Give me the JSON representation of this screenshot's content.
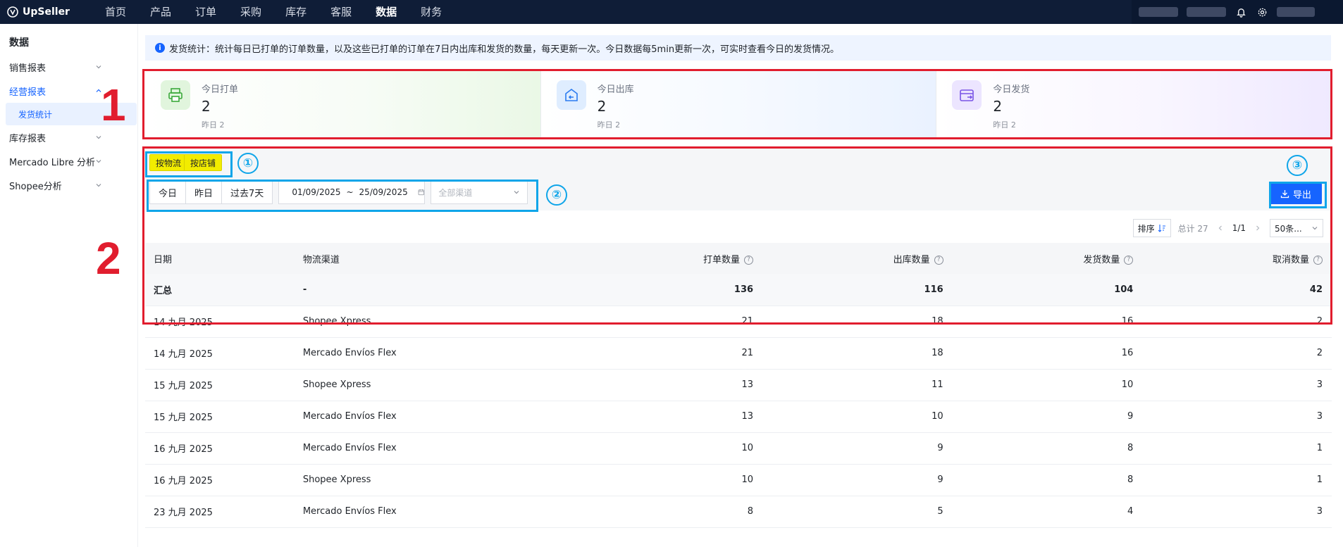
{
  "app": {
    "logo_text": "UpSeller"
  },
  "nav": {
    "items": [
      "首页",
      "产品",
      "订单",
      "采购",
      "库存",
      "客服",
      "数据",
      "财务"
    ],
    "active_index": 6
  },
  "sidebar": {
    "title": "数据",
    "items": [
      {
        "label": "销售报表",
        "open": false
      },
      {
        "label": "经营报表",
        "open": true
      },
      {
        "label": "库存报表",
        "open": false
      },
      {
        "label": "Mercado Libre 分析",
        "open": false
      },
      {
        "label": "Shopee分析",
        "open": false
      }
    ],
    "sub_item": "发货统计"
  },
  "notice": {
    "text": "发货统计：统计每日已打单的订单数量，以及这些已打单的订单在7日内出库和发货的数量，每天更新一次。今日数据每5min更新一次，可实时查看今日的发货情况。"
  },
  "stats": [
    {
      "label": "今日打单",
      "value": "2",
      "sub": "昨日 2",
      "icon": "printer-icon"
    },
    {
      "label": "今日出库",
      "value": "2",
      "sub": "昨日 2",
      "icon": "outbound-icon"
    },
    {
      "label": "今日发货",
      "value": "2",
      "sub": "昨日 2",
      "icon": "shipping-icon"
    }
  ],
  "toggles": {
    "by_logistics": "按物流",
    "by_store": "按店铺"
  },
  "filters": {
    "quick": [
      "今日",
      "昨日",
      "过去7天"
    ],
    "date_start": "01/09/2025",
    "date_sep": "~",
    "date_end": "25/09/2025",
    "channel_placeholder": "全部渠道"
  },
  "export_label": "导出",
  "annotations": {
    "num1": "1",
    "num2": "2",
    "circle1": "①",
    "circle2": "②",
    "circle3": "③"
  },
  "pager": {
    "sort_label": "排序",
    "total": "总计 27",
    "page": "1/1",
    "size": "50条..."
  },
  "table": {
    "headers": [
      "日期",
      "物流渠道",
      "打单数量",
      "出库数量",
      "发货数量",
      "取消数量"
    ],
    "total": {
      "label": "汇总",
      "channel": "-",
      "printed": "136",
      "outbound": "116",
      "shipped": "104",
      "cancelled": "42"
    },
    "rows": [
      {
        "date": "14 九月 2025",
        "channel": "Shopee Xpress",
        "printed": "21",
        "outbound": "18",
        "shipped": "16",
        "cancelled": "2"
      },
      {
        "date": "14 九月 2025",
        "channel": "Mercado Envíos Flex",
        "printed": "21",
        "outbound": "18",
        "shipped": "16",
        "cancelled": "2"
      },
      {
        "date": "15 九月 2025",
        "channel": "Shopee Xpress",
        "printed": "13",
        "outbound": "11",
        "shipped": "10",
        "cancelled": "3"
      },
      {
        "date": "15 九月 2025",
        "channel": "Mercado Envíos Flex",
        "printed": "13",
        "outbound": "10",
        "shipped": "9",
        "cancelled": "3"
      },
      {
        "date": "16 九月 2025",
        "channel": "Mercado Envíos Flex",
        "printed": "10",
        "outbound": "9",
        "shipped": "8",
        "cancelled": "1"
      },
      {
        "date": "16 九月 2025",
        "channel": "Shopee Xpress",
        "printed": "10",
        "outbound": "9",
        "shipped": "8",
        "cancelled": "1"
      },
      {
        "date": "23 九月 2025",
        "channel": "Mercado Envíos Flex",
        "printed": "8",
        "outbound": "5",
        "shipped": "4",
        "cancelled": "3"
      }
    ]
  },
  "colors": {
    "accent": "#1664ff",
    "nav_bg": "#0f1d37",
    "highlight_red": "#e11d2e",
    "highlight_blue": "#0fa5e9",
    "toggle_yellow": "#f2ec00"
  }
}
